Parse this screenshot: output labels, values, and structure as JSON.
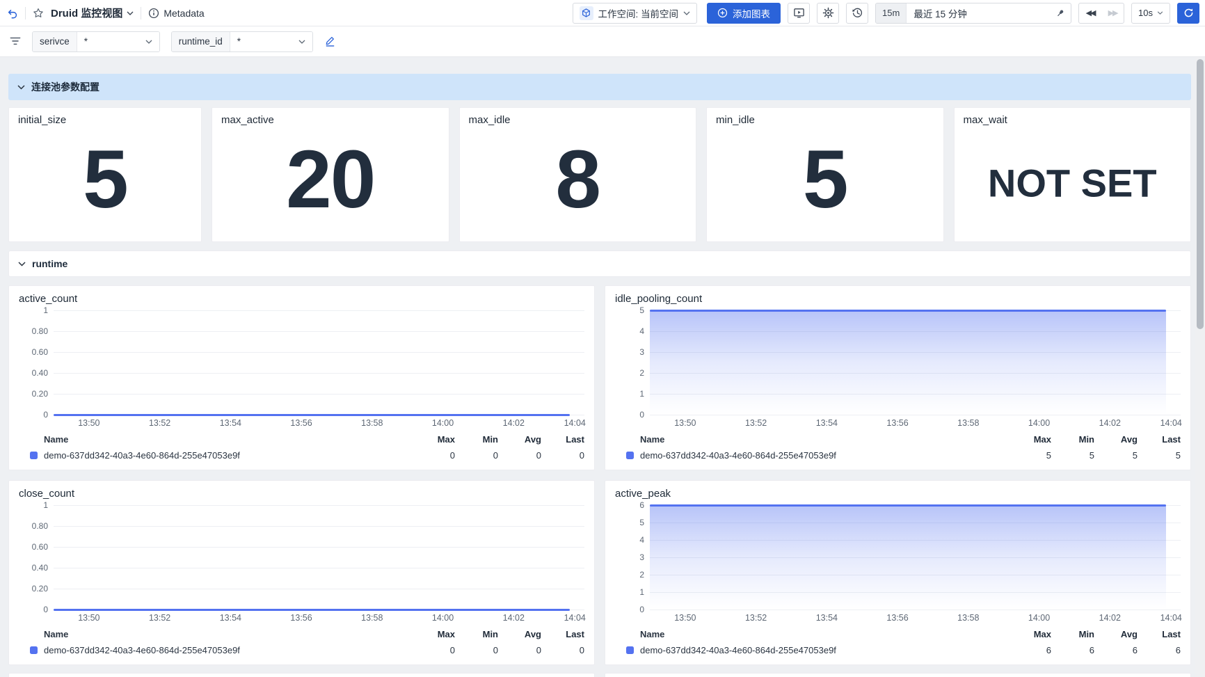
{
  "header": {
    "title": "Druid 监控视图",
    "metadata_label": "Metadata",
    "workspace_label": "工作空间: 当前空间",
    "add_chart_label": "添加图表",
    "range_badge": "15m",
    "range_label": "最近 15 分钟",
    "interval_label": "10s"
  },
  "filters": {
    "variables": [
      {
        "name": "serivce",
        "value": "*"
      },
      {
        "name": "runtime_id",
        "value": "*"
      }
    ]
  },
  "sections": [
    {
      "title": "连接池参数配置"
    },
    {
      "title": "runtime"
    }
  ],
  "stats": [
    {
      "title": "initial_size",
      "value": "5"
    },
    {
      "title": "max_active",
      "value": "20"
    },
    {
      "title": "max_idle",
      "value": "8"
    },
    {
      "title": "min_idle",
      "value": "5"
    },
    {
      "title": "max_wait",
      "value": "NOT SET"
    }
  ],
  "legend_headers": [
    "Name",
    "Max",
    "Min",
    "Avg",
    "Last"
  ],
  "colors": {
    "accent_blue": "#2b63d9",
    "chart_line": "#5472f0",
    "section_bar_bg": "#cfe4fa",
    "stat_value": "#222e3d"
  },
  "chart_data": [
    {
      "type": "line",
      "title": "active_count",
      "x_ticks": [
        "13:50",
        "13:52",
        "13:54",
        "13:56",
        "13:58",
        "14:00",
        "14:02",
        "14:04"
      ],
      "y_ticks": [
        "1",
        "0.80",
        "0.60",
        "0.40",
        "0.20",
        "0"
      ],
      "ylim": [
        0,
        1
      ],
      "fill": false,
      "grid": true,
      "legend_position": "bottom",
      "series": [
        {
          "name": "demo-637dd342-40a3-4e60-864d-255e47053e9f",
          "constant_value": 0,
          "max": 0,
          "min": 0,
          "avg": 0,
          "last": 0
        }
      ]
    },
    {
      "type": "area",
      "title": "idle_pooling_count",
      "x_ticks": [
        "13:50",
        "13:52",
        "13:54",
        "13:56",
        "13:58",
        "14:00",
        "14:02",
        "14:04"
      ],
      "y_ticks": [
        "5",
        "4",
        "3",
        "2",
        "1",
        "0"
      ],
      "ylim": [
        0,
        5
      ],
      "fill": true,
      "grid": true,
      "legend_position": "bottom",
      "series": [
        {
          "name": "demo-637dd342-40a3-4e60-864d-255e47053e9f",
          "constant_value": 5,
          "max": 5,
          "min": 5,
          "avg": 5,
          "last": 5
        }
      ]
    },
    {
      "type": "line",
      "title": "close_count",
      "x_ticks": [
        "13:50",
        "13:52",
        "13:54",
        "13:56",
        "13:58",
        "14:00",
        "14:02",
        "14:04"
      ],
      "y_ticks": [
        "1",
        "0.80",
        "0.60",
        "0.40",
        "0.20",
        "0"
      ],
      "ylim": [
        0,
        1
      ],
      "fill": false,
      "grid": true,
      "legend_position": "bottom",
      "series": [
        {
          "name": "demo-637dd342-40a3-4e60-864d-255e47053e9f",
          "constant_value": 0,
          "max": 0,
          "min": 0,
          "avg": 0,
          "last": 0
        }
      ]
    },
    {
      "type": "area",
      "title": "active_peak",
      "x_ticks": [
        "13:50",
        "13:52",
        "13:54",
        "13:56",
        "13:58",
        "14:00",
        "14:02",
        "14:04"
      ],
      "y_ticks": [
        "6",
        "5",
        "4",
        "3",
        "2",
        "1",
        "0"
      ],
      "ylim": [
        0,
        6
      ],
      "fill": true,
      "grid": true,
      "legend_position": "bottom",
      "series": [
        {
          "name": "demo-637dd342-40a3-4e60-864d-255e47053e9f",
          "constant_value": 6,
          "max": 6,
          "min": 6,
          "avg": 6,
          "last": 6
        }
      ]
    }
  ]
}
